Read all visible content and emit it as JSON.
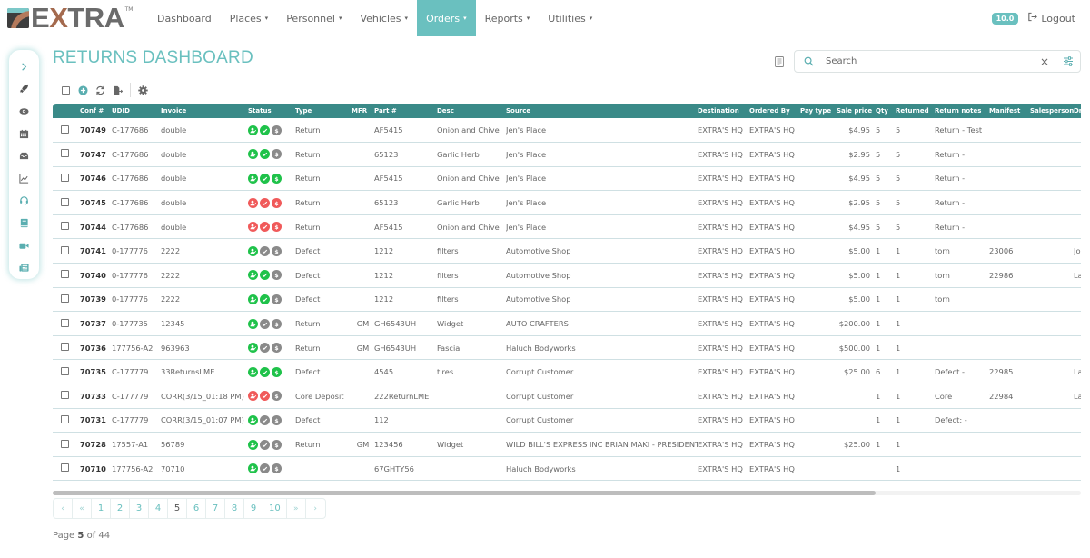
{
  "app": {
    "logo_text_pre": "E",
    "logo_text_x": "X",
    "logo_text_post": "TRA",
    "logo_tm": "TM",
    "version": "10.0",
    "logout_label": "Logout"
  },
  "nav": {
    "items": [
      {
        "label": "Dashboard",
        "dropdown": false,
        "active": false
      },
      {
        "label": "Places",
        "dropdown": true,
        "active": false
      },
      {
        "label": "Personnel",
        "dropdown": true,
        "active": false
      },
      {
        "label": "Vehicles",
        "dropdown": true,
        "active": false
      },
      {
        "label": "Orders",
        "dropdown": true,
        "active": true
      },
      {
        "label": "Reports",
        "dropdown": true,
        "active": false
      },
      {
        "label": "Utilities",
        "dropdown": true,
        "active": false
      }
    ],
    "caret": "▾"
  },
  "sidebar": {
    "items": [
      "expand",
      "rocket",
      "eye",
      "calendar",
      "inbox",
      "chart",
      "headset",
      "book",
      "video",
      "newspaper"
    ]
  },
  "page": {
    "title": "RETURNS DASHBOARD"
  },
  "search": {
    "placeholder": "Search",
    "value": "",
    "clear_label": "×"
  },
  "colors": {
    "accent": "#6ac0bf",
    "header_bg": "#3a8a88",
    "status_green": "#1fc24a",
    "status_red": "#f05a5a",
    "status_gray": "#8a8a8a"
  },
  "table": {
    "columns": [
      "",
      "Conf #",
      "UDID",
      "Invoice",
      "Status",
      "Type",
      "MFR",
      "Part #",
      "Desc",
      "Source",
      "Destination",
      "Ordered By",
      "Pay type",
      "Sale price",
      "Qty",
      "Returned",
      "Return notes",
      "Manifest",
      "Salesperson",
      "Dr"
    ],
    "rows": [
      {
        "conf": "70749",
        "udid": "C-177686",
        "invoice": "double",
        "status": [
          "green",
          "green",
          "gray"
        ],
        "type": "Return",
        "mfr": "",
        "part": "AF5415",
        "desc": "Onion and Chive",
        "source": "Jen's Place",
        "dest": "EXTRA'S HQ",
        "ordered_by": "EXTRA'S HQ",
        "pay_type": "",
        "price": "$4.95",
        "qty": "5",
        "returned": "5",
        "notes": "Return - Test",
        "manifest": "",
        "salesperson": "",
        "dr": ""
      },
      {
        "conf": "70747",
        "udid": "C-177686",
        "invoice": "double",
        "status": [
          "green",
          "green",
          "gray"
        ],
        "type": "Return",
        "mfr": "",
        "part": "65123",
        "desc": "Garlic Herb",
        "source": "Jen's Place",
        "dest": "EXTRA'S HQ",
        "ordered_by": "EXTRA'S HQ",
        "pay_type": "",
        "price": "$2.95",
        "qty": "5",
        "returned": "5",
        "notes": "Return -",
        "manifest": "",
        "salesperson": "",
        "dr": ""
      },
      {
        "conf": "70746",
        "udid": "C-177686",
        "invoice": "double",
        "status": [
          "green",
          "green",
          "green"
        ],
        "type": "Return",
        "mfr": "",
        "part": "AF5415",
        "desc": "Onion and Chive",
        "source": "Jen's Place",
        "dest": "EXTRA'S HQ",
        "ordered_by": "EXTRA'S HQ",
        "pay_type": "",
        "price": "$4.95",
        "qty": "5",
        "returned": "5",
        "notes": "Return -",
        "manifest": "",
        "salesperson": "",
        "dr": ""
      },
      {
        "conf": "70745",
        "udid": "C-177686",
        "invoice": "double",
        "status": [
          "red",
          "red",
          "red"
        ],
        "type": "Return",
        "mfr": "",
        "part": "65123",
        "desc": "Garlic Herb",
        "source": "Jen's Place",
        "dest": "EXTRA'S HQ",
        "ordered_by": "EXTRA'S HQ",
        "pay_type": "",
        "price": "$2.95",
        "qty": "5",
        "returned": "5",
        "notes": "Return -",
        "manifest": "",
        "salesperson": "",
        "dr": ""
      },
      {
        "conf": "70744",
        "udid": "C-177686",
        "invoice": "double",
        "status": [
          "red",
          "red",
          "red"
        ],
        "type": "Return",
        "mfr": "",
        "part": "AF5415",
        "desc": "Onion and Chive",
        "source": "Jen's Place",
        "dest": "EXTRA'S HQ",
        "ordered_by": "EXTRA'S HQ",
        "pay_type": "",
        "price": "$4.95",
        "qty": "5",
        "returned": "5",
        "notes": "Return -",
        "manifest": "",
        "salesperson": "",
        "dr": ""
      },
      {
        "conf": "70741",
        "udid": "0-177776",
        "invoice": "2222",
        "status": [
          "green",
          "gray",
          "gray"
        ],
        "type": "Defect",
        "mfr": "",
        "part": "1212",
        "desc": "filters",
        "source": "Automotive Shop",
        "dest": "EXTRA'S HQ",
        "ordered_by": "EXTRA'S HQ",
        "pay_type": "",
        "price": "$5.00",
        "qty": "1",
        "returned": "1",
        "notes": "torn",
        "manifest": "23006",
        "salesperson": "",
        "dr": "Jo"
      },
      {
        "conf": "70740",
        "udid": "0-177776",
        "invoice": "2222",
        "status": [
          "green",
          "green",
          "gray"
        ],
        "type": "Defect",
        "mfr": "",
        "part": "1212",
        "desc": "filters",
        "source": "Automotive Shop",
        "dest": "EXTRA'S HQ",
        "ordered_by": "EXTRA'S HQ",
        "pay_type": "",
        "price": "$5.00",
        "qty": "1",
        "returned": "1",
        "notes": "torn",
        "manifest": "22986",
        "salesperson": "",
        "dr": "La"
      },
      {
        "conf": "70739",
        "udid": "0-177776",
        "invoice": "2222",
        "status": [
          "green",
          "green",
          "gray"
        ],
        "type": "Defect",
        "mfr": "",
        "part": "1212",
        "desc": "filters",
        "source": "Automotive Shop",
        "dest": "EXTRA'S HQ",
        "ordered_by": "EXTRA'S HQ",
        "pay_type": "",
        "price": "$5.00",
        "qty": "1",
        "returned": "1",
        "notes": "torn",
        "manifest": "",
        "salesperson": "",
        "dr": ""
      },
      {
        "conf": "70737",
        "udid": "0-177735",
        "invoice": "12345",
        "status": [
          "green",
          "gray",
          "gray"
        ],
        "type": "Return",
        "mfr": "GM",
        "part": "GH6543UH",
        "desc": "Widget",
        "source": "AUTO CRAFTERS",
        "dest": "EXTRA'S HQ",
        "ordered_by": "EXTRA'S HQ",
        "pay_type": "",
        "price": "$200.00",
        "qty": "1",
        "returned": "1",
        "notes": "",
        "manifest": "",
        "salesperson": "",
        "dr": ""
      },
      {
        "conf": "70736",
        "udid": "177756-A2",
        "invoice": "963963",
        "status": [
          "green",
          "gray",
          "gray"
        ],
        "type": "Return",
        "mfr": "GM",
        "part": "GH6543UH",
        "desc": "Fascia",
        "source": "Haluch Bodyworks",
        "dest": "EXTRA'S HQ",
        "ordered_by": "EXTRA'S HQ",
        "pay_type": "",
        "price": "$500.00",
        "qty": "1",
        "returned": "1",
        "notes": "",
        "manifest": "",
        "salesperson": "",
        "dr": ""
      },
      {
        "conf": "70735",
        "udid": "C-177779",
        "invoice": "33ReturnsLME",
        "status": [
          "green",
          "green",
          "green"
        ],
        "type": "Defect",
        "mfr": "",
        "part": "4545",
        "desc": "tires",
        "source": "Corrupt Customer",
        "dest": "EXTRA'S HQ",
        "ordered_by": "EXTRA'S HQ",
        "pay_type": "",
        "price": "$25.00",
        "qty": "6",
        "returned": "1",
        "notes": "Defect -",
        "manifest": "22985",
        "salesperson": "",
        "dr": "La"
      },
      {
        "conf": "70733",
        "udid": "C-177779",
        "invoice": "CORR(3/15_01:18 PM)",
        "status": [
          "red",
          "red",
          "gray"
        ],
        "type": "Core Deposit",
        "mfr": "",
        "part": "222ReturnLME",
        "desc": "",
        "source": "Corrupt Customer",
        "dest": "EXTRA'S HQ",
        "ordered_by": "EXTRA'S HQ",
        "pay_type": "",
        "price": "",
        "qty": "1",
        "returned": "1",
        "notes": "Core",
        "manifest": "22984",
        "salesperson": "",
        "dr": "La"
      },
      {
        "conf": "70731",
        "udid": "C-177779",
        "invoice": "CORR(3/15_01:07 PM)",
        "status": [
          "green",
          "gray",
          "gray"
        ],
        "type": "Defect",
        "mfr": "",
        "part": "112",
        "desc": "",
        "source": "Corrupt Customer",
        "dest": "EXTRA'S HQ",
        "ordered_by": "EXTRA'S HQ",
        "pay_type": "",
        "price": "",
        "qty": "1",
        "returned": "1",
        "notes": "Defect: -",
        "manifest": "",
        "salesperson": "",
        "dr": ""
      },
      {
        "conf": "70728",
        "udid": "17557-A1",
        "invoice": "56789",
        "status": [
          "green",
          "gray",
          "gray"
        ],
        "type": "Return",
        "mfr": "GM",
        "part": "123456",
        "desc": "Widget",
        "source": "WILD BILL'S EXPRESS INC BRIAN MAKI - PRESIDENT",
        "dest": "EXTRA'S HQ",
        "ordered_by": "EXTRA'S HQ",
        "pay_type": "",
        "price": "$25.00",
        "qty": "1",
        "returned": "1",
        "notes": "",
        "manifest": "",
        "salesperson": "",
        "dr": ""
      },
      {
        "conf": "70710",
        "udid": "177756-A2",
        "invoice": "70710",
        "status": [
          "green",
          "gray",
          "gray"
        ],
        "type": "",
        "mfr": "",
        "part": "67GHTY56",
        "desc": "",
        "source": "Haluch Bodyworks",
        "dest": "EXTRA'S HQ",
        "ordered_by": "EXTRA'S HQ",
        "pay_type": "",
        "price": "",
        "qty": "",
        "returned": "1",
        "notes": "",
        "manifest": "",
        "salesperson": "",
        "dr": ""
      }
    ]
  },
  "pagination": {
    "prev": "‹",
    "first": "«",
    "pages": [
      "1",
      "2",
      "3",
      "4",
      "5",
      "6",
      "7",
      "8",
      "9",
      "10"
    ],
    "current": "5",
    "last": "»",
    "next": "›",
    "info_prefix": "Page",
    "info_current": "5",
    "info_of": "of",
    "info_total": "44"
  }
}
